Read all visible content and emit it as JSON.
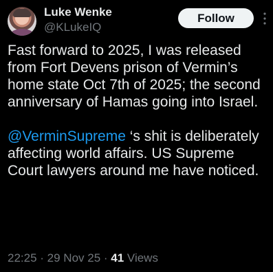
{
  "author": {
    "display_name": "Luke Wenke",
    "handle": "@KLukeIQ"
  },
  "follow_label": "Follow",
  "tweet": {
    "paragraph_1": "Fast forward to 2025, I was released from Fort Devens prison of Vermin’s home state Oct 7th of 2025; the second anniversary of Hamas going into Israel.",
    "mention": "@VerminSupreme",
    "paragraph_2_rest": " ‘s shit is deliberately affecting world affairs. US Supreme Court lawyers around me have noticed."
  },
  "meta": {
    "time": "22:25",
    "separator": " · ",
    "date": "29 Nov 25",
    "views_count": "41",
    "views_label": " Views"
  },
  "colors": {
    "background": "#000000",
    "text": "#e7e9ea",
    "secondary": "#71767b",
    "link": "#1d9bf0",
    "follow_bg": "#eff3f4"
  },
  "icons": [
    "avatar",
    "more-icon"
  ]
}
